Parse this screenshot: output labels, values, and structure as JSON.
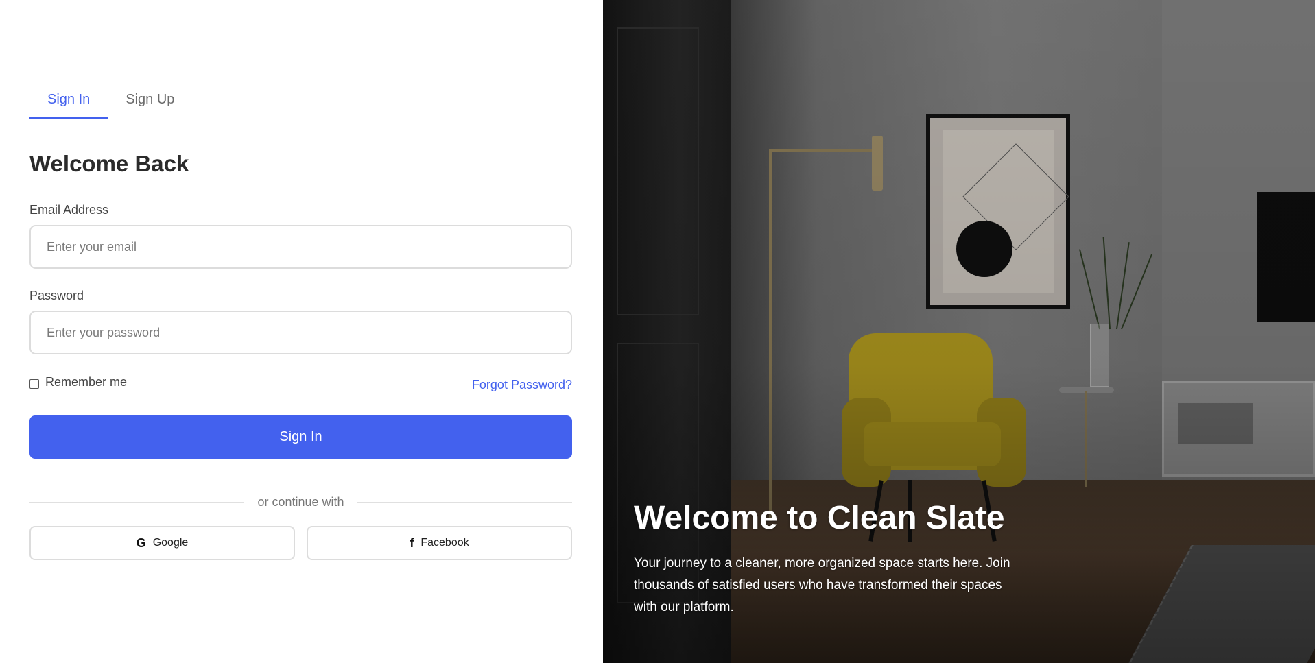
{
  "auth": {
    "tabs": [
      {
        "label": "Sign In",
        "active": true
      },
      {
        "label": "Sign Up",
        "active": false
      }
    ],
    "title": "Welcome Back",
    "email": {
      "label": "Email Address",
      "placeholder": "Enter your email",
      "value": ""
    },
    "password": {
      "label": "Password",
      "placeholder": "Enter your password",
      "value": ""
    },
    "remember_label": "Remember me",
    "remember_checked": false,
    "forgot_label": "Forgot Password?",
    "submit_label": "Sign In",
    "divider_text": "or continue with",
    "social": [
      {
        "label": "Google",
        "icon": "google-icon"
      },
      {
        "label": "Facebook",
        "icon": "facebook-icon"
      }
    ]
  },
  "hero": {
    "title": "Welcome to Clean Slate",
    "text": "Your journey to a cleaner, more organized space starts here. Join thousands of satisfied users who have transformed their spaces with our platform."
  },
  "colors": {
    "accent": "#4361ee",
    "text": "#333333",
    "border": "#dcdcdc"
  }
}
